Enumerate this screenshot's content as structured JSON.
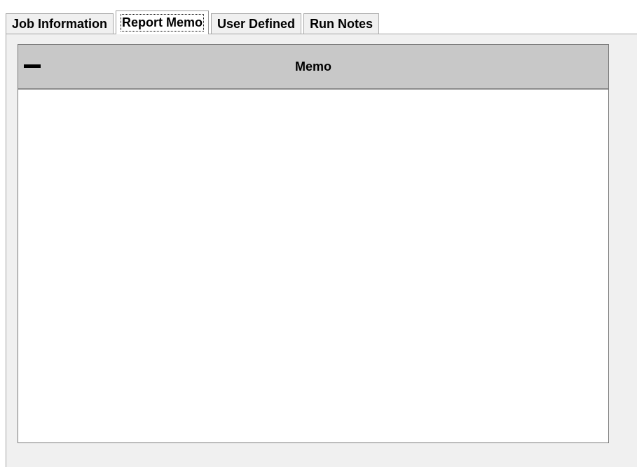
{
  "tabs": [
    {
      "label": "Job Information",
      "active": false
    },
    {
      "label": "Report Memo",
      "active": true
    },
    {
      "label": "User Defined",
      "active": false
    },
    {
      "label": "Run Notes",
      "active": false
    }
  ],
  "memo": {
    "title": "Memo",
    "content": "",
    "collapse_icon": "minus-icon"
  }
}
